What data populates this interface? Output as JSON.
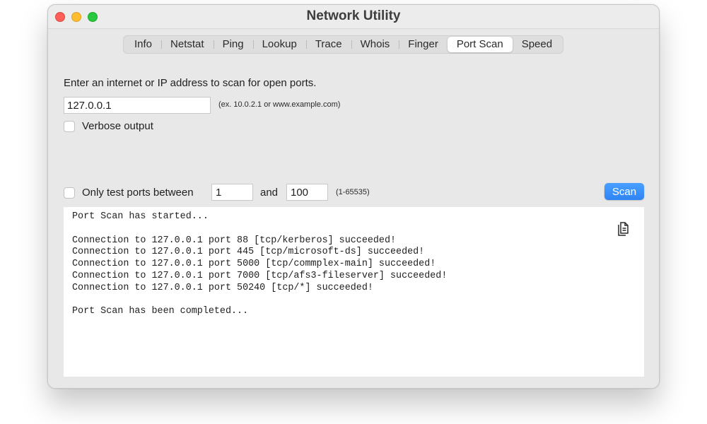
{
  "window": {
    "title": "Network Utility"
  },
  "tabs": [
    {
      "label": "Info",
      "active": false
    },
    {
      "label": "Netstat",
      "active": false
    },
    {
      "label": "Ping",
      "active": false
    },
    {
      "label": "Lookup",
      "active": false
    },
    {
      "label": "Trace",
      "active": false
    },
    {
      "label": "Whois",
      "active": false
    },
    {
      "label": "Finger",
      "active": false
    },
    {
      "label": "Port Scan",
      "active": true
    },
    {
      "label": "Speed",
      "active": false
    }
  ],
  "port_scan": {
    "prompt": "Enter an internet or IP address to scan for open ports.",
    "address_value": "127.0.0.1",
    "address_hint": "(ex. 10.0.2.1 or www.example.com)",
    "verbose_label": "Verbose output",
    "verbose_checked": false,
    "range_label": "Only test ports between",
    "range_checked": false,
    "range_from": "1",
    "range_and_label": "and",
    "range_to": "100",
    "range_hint": "(1-65535)",
    "scan_button_label": "Scan",
    "output_lines": [
      "Port Scan has started...",
      "",
      "Connection to 127.0.0.1 port 88 [tcp/kerberos] succeeded!",
      "Connection to 127.0.0.1 port 445 [tcp/microsoft-ds] succeeded!",
      "Connection to 127.0.0.1 port 5000 [tcp/commplex-main] succeeded!",
      "Connection to 127.0.0.1 port 7000 [tcp/afs3-fileserver] succeeded!",
      "Connection to 127.0.0.1 port 50240 [tcp/*] succeeded!",
      "",
      "Port Scan has been completed..."
    ]
  },
  "icons": {
    "copy": "copy-icon",
    "close": "close-window-icon",
    "minimize": "minimize-window-icon",
    "maximize": "maximize-window-icon"
  },
  "colors": {
    "accent": "#2f84f5",
    "close": "#ff5f57",
    "minimize": "#febc2e",
    "maximize": "#28c840"
  }
}
